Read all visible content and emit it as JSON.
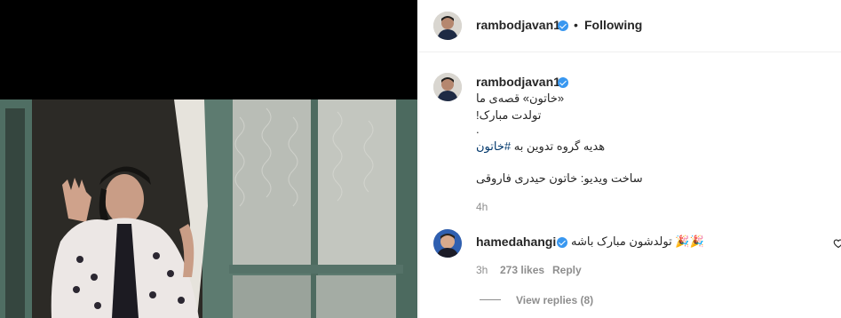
{
  "post": {
    "author": "rambodjavan1",
    "follow_status": "Following",
    "separator": "•"
  },
  "caption": {
    "author": "rambodjavan1",
    "line1": "«خاتون» قصه‌ی ما",
    "line2": "تولدت مبارک!",
    "dot": ".",
    "line3_prefix": "هدیه گروه تدوین به",
    "line3_hashtag": "#خاتون",
    "line4": "ساخت ویدیو: خاتون حیدری فاروقی",
    "time": "4h"
  },
  "comment": {
    "author": "hamedahangi",
    "text": "تولدشون مبارک باشه",
    "emoji": "🎉🎉",
    "time": "3h",
    "likes": "273 likes",
    "reply_label": "Reply",
    "view_replies": "View replies (8)"
  },
  "colors": {
    "verified": "#3897f0",
    "hashtag": "#00376b",
    "meta": "#8e8e8e"
  },
  "icons": [
    "verified-badge-icon",
    "party-popper-icon",
    "like-heart-icon"
  ]
}
